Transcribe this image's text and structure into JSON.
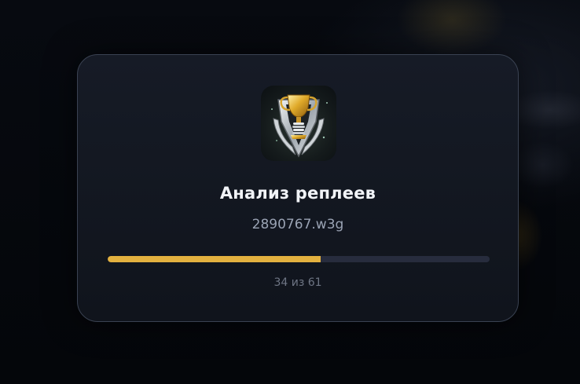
{
  "dialog": {
    "icon": "trophy-shield-icon",
    "title": "Анализ реплеев",
    "filename": "2890767.w3g",
    "progress": {
      "current": 34,
      "total": 61,
      "label": "34 из 61",
      "fill_color": "#e3b13f",
      "track_color": "#272c3d"
    }
  },
  "colors": {
    "background": "#05070b",
    "modal_background": "#131821",
    "modal_border": "#3a4252",
    "title": "#f1f3f7",
    "subtitle": "#9aa3b4",
    "muted": "#6e7584",
    "accent": "#e3b13f"
  }
}
